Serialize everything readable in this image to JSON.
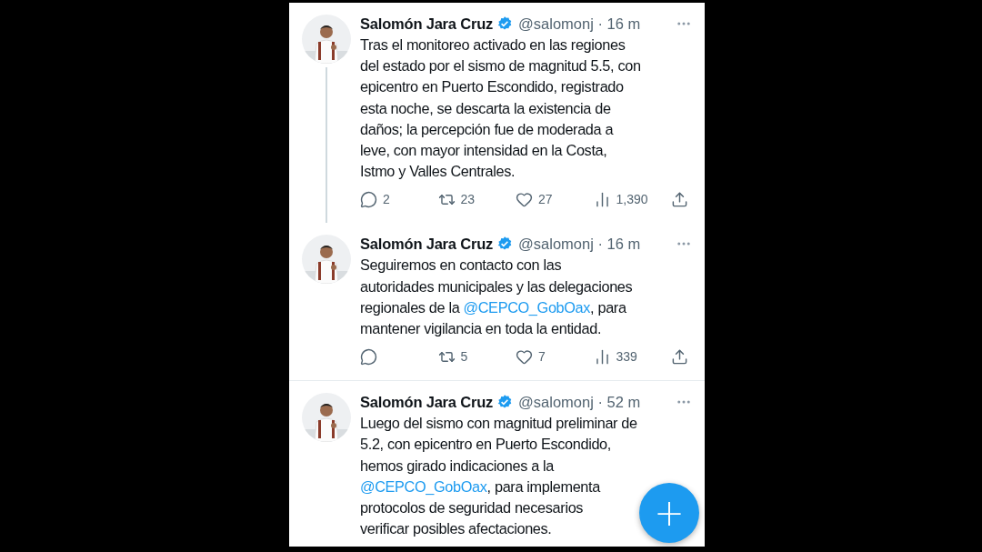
{
  "tweets": [
    {
      "author": "Salomón Jara Cruz",
      "verified": true,
      "meta": "@salomonj · 16 m",
      "thread": true,
      "lines": [
        [
          {
            "kind": "text",
            "text": "Tras el monitoreo activado en las regiones"
          }
        ],
        [
          {
            "kind": "text",
            "text": "del estado por el sismo de magnitud 5.5, con"
          }
        ],
        [
          {
            "kind": "text",
            "text": "epicentro en Puerto Escondido, registrado"
          }
        ],
        [
          {
            "kind": "text",
            "text": "esta noche, se descarta la existencia de"
          }
        ],
        [
          {
            "kind": "text",
            "text": "daños; la percepción fue de moderada a"
          }
        ],
        [
          {
            "kind": "text",
            "text": "leve, con mayor intensidad en la Costa,"
          }
        ],
        [
          {
            "kind": "text",
            "text": "Istmo y Valles Centrales."
          }
        ]
      ],
      "actions": [
        {
          "kind": "reply",
          "count": "2"
        },
        {
          "kind": "repost",
          "count": "23"
        },
        {
          "kind": "like",
          "count": "27"
        },
        {
          "kind": "views",
          "count": "1,390"
        },
        {
          "kind": "share"
        }
      ]
    },
    {
      "author": "Salomón Jara Cruz",
      "verified": true,
      "meta": "@salomonj · 16 m",
      "thread": false,
      "lines": [
        [
          {
            "kind": "text",
            "text": "Seguiremos en contacto con las"
          }
        ],
        [
          {
            "kind": "text",
            "text": "autoridades municipales y las delegaciones"
          }
        ],
        [
          {
            "kind": "text",
            "text": "regionales de la "
          },
          {
            "kind": "mention",
            "text": "@CEPCO_GobOax"
          },
          {
            "kind": "text",
            "text": ", para"
          }
        ],
        [
          {
            "kind": "text",
            "text": "mantener vigilancia en toda la entidad."
          }
        ]
      ],
      "actions": [
        {
          "kind": "reply"
        },
        {
          "kind": "repost",
          "count": "5"
        },
        {
          "kind": "like",
          "count": "7"
        },
        {
          "kind": "views",
          "count": "339"
        },
        {
          "kind": "share"
        }
      ]
    },
    {
      "author": "Salomón Jara Cruz",
      "verified": true,
      "meta": "@salomonj · 52 m",
      "thread": false,
      "lines": [
        [
          {
            "kind": "text",
            "text": "Luego del sismo con magnitud preliminar de"
          }
        ],
        [
          {
            "kind": "text",
            "text": "5.2, con epicentro en Puerto Escondido,"
          }
        ],
        [
          {
            "kind": "text",
            "text": "hemos girado indicaciones a la"
          }
        ],
        [
          {
            "kind": "mention",
            "text": "@CEPCO_GobOax"
          },
          {
            "kind": "text",
            "text": ", para implementa"
          }
        ],
        [
          {
            "kind": "text",
            "text": "protocolos de seguridad necesarios"
          }
        ],
        [
          {
            "kind": "text",
            "text": "verificar posibles afectaciones."
          }
        ]
      ]
    }
  ],
  "compose_button": {
    "label": "+"
  }
}
